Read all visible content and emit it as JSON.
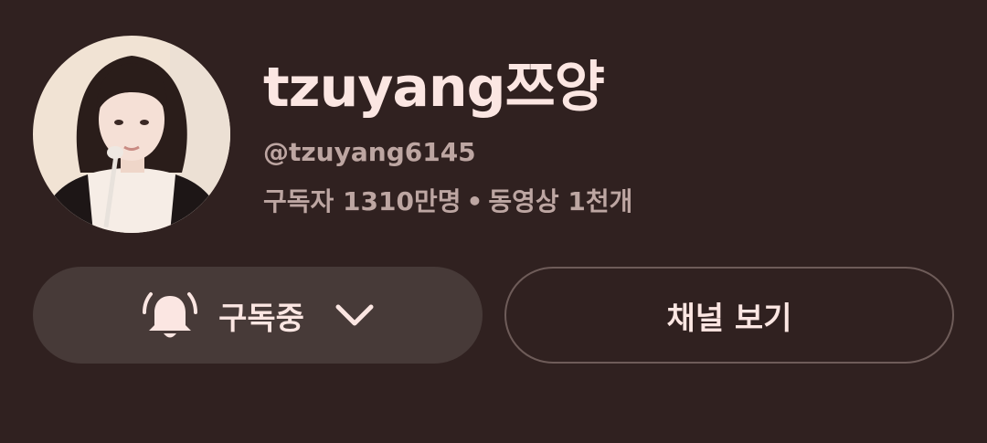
{
  "channel": {
    "name": "tzuyang쯔양",
    "handle": "@tzuyang6145",
    "subscribers": "구독자 1310만명",
    "separator": "•",
    "videos": "동영상 1천개"
  },
  "actions": {
    "subscribe_label": "구독중",
    "view_channel_label": "채널 보기"
  },
  "icons": {
    "bell": "bell-ringing-icon",
    "chevron": "chevron-down-icon"
  },
  "colors": {
    "background": "#302120",
    "subscribed_button": "#473a38",
    "text_primary": "#fbe6e2",
    "text_secondary": "#bda6a2"
  }
}
